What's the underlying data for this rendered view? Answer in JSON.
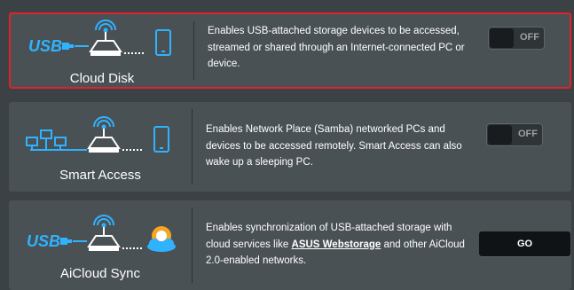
{
  "colors": {
    "accent_blue": "#2fb3ff",
    "selected_border": "#e0222b"
  },
  "features": [
    {
      "title": "Cloud Disk",
      "description": "Enables USB-attached storage devices to be accessed, streamed or shared through an Internet-connected PC or device.",
      "control": "toggle",
      "toggle_label": "OFF",
      "toggle_on": false,
      "icons": [
        "usb-icon",
        "router-icon",
        "phone-icon"
      ],
      "usb_text": "USB"
    },
    {
      "title": "Smart Access",
      "description": "Enables Network Place (Samba) networked PCs and devices to be accessed remotely. Smart Access can also wake up a sleeping PC.",
      "control": "toggle",
      "toggle_label": "OFF",
      "toggle_on": false,
      "icons": [
        "network-pcs-icon",
        "router-icon",
        "phone-icon"
      ]
    },
    {
      "title": "AiCloud Sync",
      "desc_before": "Enables synchronization of USB-attached storage with cloud services like ",
      "desc_link": "ASUS Webstorage",
      "desc_after": " and other AiCloud 2.0-enabled networks.",
      "control": "button",
      "button_label": "GO",
      "icons": [
        "usb-icon",
        "router-icon",
        "cloud-sync-icon"
      ],
      "usb_text": "USB"
    }
  ]
}
